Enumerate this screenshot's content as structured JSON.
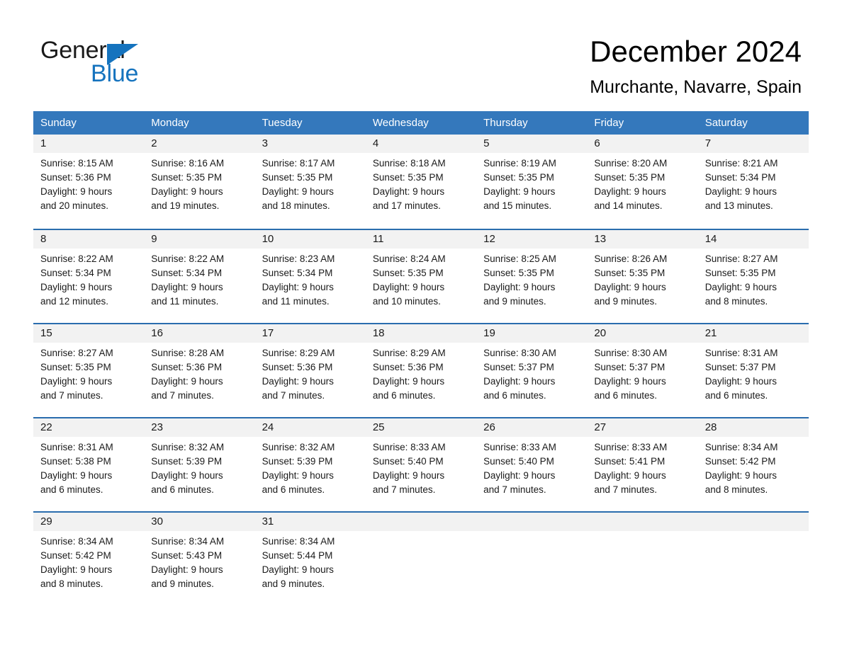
{
  "brand": {
    "name_part1": "General",
    "name_part2": "Blue",
    "color_dark": "#1a1a1a",
    "color_blue": "#1573be"
  },
  "header": {
    "month_title": "December 2024",
    "location": "Murchante, Navarre, Spain"
  },
  "theme": {
    "header_blue": "#3478bc",
    "row_rule_blue": "#2a6dae",
    "date_band_gray": "#f2f2f2"
  },
  "calendar": {
    "weekdays": [
      "Sunday",
      "Monday",
      "Tuesday",
      "Wednesday",
      "Thursday",
      "Friday",
      "Saturday"
    ],
    "weeks": [
      [
        {
          "day": "1",
          "lines": [
            "Sunrise: 8:15 AM",
            "Sunset: 5:36 PM",
            "Daylight: 9 hours",
            "and 20 minutes."
          ]
        },
        {
          "day": "2",
          "lines": [
            "Sunrise: 8:16 AM",
            "Sunset: 5:35 PM",
            "Daylight: 9 hours",
            "and 19 minutes."
          ]
        },
        {
          "day": "3",
          "lines": [
            "Sunrise: 8:17 AM",
            "Sunset: 5:35 PM",
            "Daylight: 9 hours",
            "and 18 minutes."
          ]
        },
        {
          "day": "4",
          "lines": [
            "Sunrise: 8:18 AM",
            "Sunset: 5:35 PM",
            "Daylight: 9 hours",
            "and 17 minutes."
          ]
        },
        {
          "day": "5",
          "lines": [
            "Sunrise: 8:19 AM",
            "Sunset: 5:35 PM",
            "Daylight: 9 hours",
            "and 15 minutes."
          ]
        },
        {
          "day": "6",
          "lines": [
            "Sunrise: 8:20 AM",
            "Sunset: 5:35 PM",
            "Daylight: 9 hours",
            "and 14 minutes."
          ]
        },
        {
          "day": "7",
          "lines": [
            "Sunrise: 8:21 AM",
            "Sunset: 5:34 PM",
            "Daylight: 9 hours",
            "and 13 minutes."
          ]
        }
      ],
      [
        {
          "day": "8",
          "lines": [
            "Sunrise: 8:22 AM",
            "Sunset: 5:34 PM",
            "Daylight: 9 hours",
            "and 12 minutes."
          ]
        },
        {
          "day": "9",
          "lines": [
            "Sunrise: 8:22 AM",
            "Sunset: 5:34 PM",
            "Daylight: 9 hours",
            "and 11 minutes."
          ]
        },
        {
          "day": "10",
          "lines": [
            "Sunrise: 8:23 AM",
            "Sunset: 5:34 PM",
            "Daylight: 9 hours",
            "and 11 minutes."
          ]
        },
        {
          "day": "11",
          "lines": [
            "Sunrise: 8:24 AM",
            "Sunset: 5:35 PM",
            "Daylight: 9 hours",
            "and 10 minutes."
          ]
        },
        {
          "day": "12",
          "lines": [
            "Sunrise: 8:25 AM",
            "Sunset: 5:35 PM",
            "Daylight: 9 hours",
            "and 9 minutes."
          ]
        },
        {
          "day": "13",
          "lines": [
            "Sunrise: 8:26 AM",
            "Sunset: 5:35 PM",
            "Daylight: 9 hours",
            "and 9 minutes."
          ]
        },
        {
          "day": "14",
          "lines": [
            "Sunrise: 8:27 AM",
            "Sunset: 5:35 PM",
            "Daylight: 9 hours",
            "and 8 minutes."
          ]
        }
      ],
      [
        {
          "day": "15",
          "lines": [
            "Sunrise: 8:27 AM",
            "Sunset: 5:35 PM",
            "Daylight: 9 hours",
            "and 7 minutes."
          ]
        },
        {
          "day": "16",
          "lines": [
            "Sunrise: 8:28 AM",
            "Sunset: 5:36 PM",
            "Daylight: 9 hours",
            "and 7 minutes."
          ]
        },
        {
          "day": "17",
          "lines": [
            "Sunrise: 8:29 AM",
            "Sunset: 5:36 PM",
            "Daylight: 9 hours",
            "and 7 minutes."
          ]
        },
        {
          "day": "18",
          "lines": [
            "Sunrise: 8:29 AM",
            "Sunset: 5:36 PM",
            "Daylight: 9 hours",
            "and 6 minutes."
          ]
        },
        {
          "day": "19",
          "lines": [
            "Sunrise: 8:30 AM",
            "Sunset: 5:37 PM",
            "Daylight: 9 hours",
            "and 6 minutes."
          ]
        },
        {
          "day": "20",
          "lines": [
            "Sunrise: 8:30 AM",
            "Sunset: 5:37 PM",
            "Daylight: 9 hours",
            "and 6 minutes."
          ]
        },
        {
          "day": "21",
          "lines": [
            "Sunrise: 8:31 AM",
            "Sunset: 5:37 PM",
            "Daylight: 9 hours",
            "and 6 minutes."
          ]
        }
      ],
      [
        {
          "day": "22",
          "lines": [
            "Sunrise: 8:31 AM",
            "Sunset: 5:38 PM",
            "Daylight: 9 hours",
            "and 6 minutes."
          ]
        },
        {
          "day": "23",
          "lines": [
            "Sunrise: 8:32 AM",
            "Sunset: 5:39 PM",
            "Daylight: 9 hours",
            "and 6 minutes."
          ]
        },
        {
          "day": "24",
          "lines": [
            "Sunrise: 8:32 AM",
            "Sunset: 5:39 PM",
            "Daylight: 9 hours",
            "and 6 minutes."
          ]
        },
        {
          "day": "25",
          "lines": [
            "Sunrise: 8:33 AM",
            "Sunset: 5:40 PM",
            "Daylight: 9 hours",
            "and 7 minutes."
          ]
        },
        {
          "day": "26",
          "lines": [
            "Sunrise: 8:33 AM",
            "Sunset: 5:40 PM",
            "Daylight: 9 hours",
            "and 7 minutes."
          ]
        },
        {
          "day": "27",
          "lines": [
            "Sunrise: 8:33 AM",
            "Sunset: 5:41 PM",
            "Daylight: 9 hours",
            "and 7 minutes."
          ]
        },
        {
          "day": "28",
          "lines": [
            "Sunrise: 8:34 AM",
            "Sunset: 5:42 PM",
            "Daylight: 9 hours",
            "and 8 minutes."
          ]
        }
      ],
      [
        {
          "day": "29",
          "lines": [
            "Sunrise: 8:34 AM",
            "Sunset: 5:42 PM",
            "Daylight: 9 hours",
            "and 8 minutes."
          ]
        },
        {
          "day": "30",
          "lines": [
            "Sunrise: 8:34 AM",
            "Sunset: 5:43 PM",
            "Daylight: 9 hours",
            "and 9 minutes."
          ]
        },
        {
          "day": "31",
          "lines": [
            "Sunrise: 8:34 AM",
            "Sunset: 5:44 PM",
            "Daylight: 9 hours",
            "and 9 minutes."
          ]
        },
        {
          "day": "",
          "lines": []
        },
        {
          "day": "",
          "lines": []
        },
        {
          "day": "",
          "lines": []
        },
        {
          "day": "",
          "lines": []
        }
      ]
    ]
  }
}
